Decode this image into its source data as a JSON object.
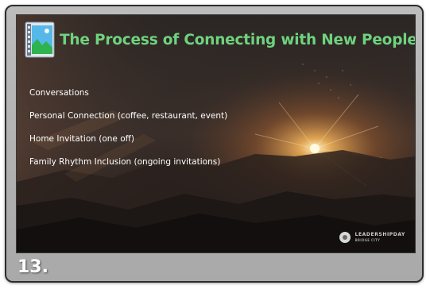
{
  "slide": {
    "title": "The Process of Connecting with New People",
    "icon": "image-gallery-icon",
    "bullets": [
      "Conversations",
      "Personal Connection (coffee, restaurant, event)",
      "Home Invitation (one off)",
      "Family Rhythm Inclusion (ongoing invitations)"
    ],
    "logo": {
      "name": "LEADERSHIPDAY",
      "tagline": "BRIDGE CITY"
    }
  },
  "slide_number": "13.",
  "colors": {
    "title": "#6fd37e",
    "text": "#ffffff",
    "frame": "#b5b5b5",
    "slide_background": "#1b1816"
  }
}
